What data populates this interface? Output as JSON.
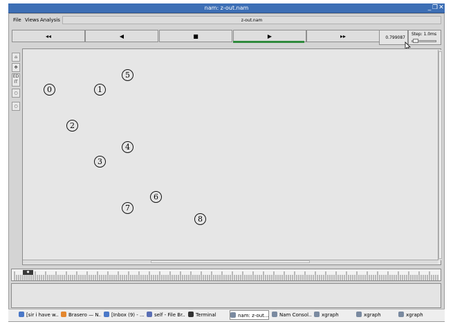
{
  "window": {
    "title": "nam: z-out.nam",
    "file_name": "z-out.nam"
  },
  "menu": {
    "file": "File",
    "views": "Views",
    "analysis": "Analysis"
  },
  "transport": {
    "rewind": "◂◂",
    "back": "◀",
    "stop": "■",
    "play": "▶",
    "fast_forward": "▸▸",
    "time": "0.799087",
    "step_label": "Step: 1.0ms"
  },
  "tools": [
    "⌂",
    "✥",
    "ED IT",
    "○",
    "○"
  ],
  "nodes": [
    {
      "id": "0",
      "label": "0"
    },
    {
      "id": "1",
      "label": "1"
    },
    {
      "id": "2",
      "label": "2"
    },
    {
      "id": "3",
      "label": "3"
    },
    {
      "id": "4",
      "label": "4"
    },
    {
      "id": "5",
      "label": "5"
    },
    {
      "id": "6",
      "label": "6"
    },
    {
      "id": "7",
      "label": "7"
    },
    {
      "id": "8",
      "label": "8"
    }
  ],
  "taskbar": [
    {
      "label": "[sir i have w...",
      "icon_color": "#4a78c8",
      "icon": "browser-icon"
    },
    {
      "label": "Brasero — N...",
      "icon_color": "#e4872e",
      "icon": "brasero-icon"
    },
    {
      "label": "[Inbox (9) - ...",
      "icon_color": "#4a78c8",
      "icon": "mail-icon"
    },
    {
      "label": "self - File Br...",
      "icon_color": "#5a6fb5",
      "icon": "folder-icon"
    },
    {
      "label": "Terminal",
      "icon_color": "#333333",
      "icon": "terminal-icon"
    },
    {
      "label": "nam: z-out....",
      "icon_color": "#7a8aa0",
      "icon": "window-icon"
    },
    {
      "label": "Nam Consol...",
      "icon_color": "#7a8aa0",
      "icon": "window-icon"
    },
    {
      "label": "xgraph",
      "icon_color": "#7a8aa0",
      "icon": "window-icon"
    },
    {
      "label": "xgraph",
      "icon_color": "#7a8aa0",
      "icon": "window-icon"
    },
    {
      "label": "xgraph",
      "icon_color": "#7a8aa0",
      "icon": "window-icon"
    }
  ],
  "colors": {
    "titlebar": "#3d6fb5",
    "play_progress": "#2f8a3c",
    "canvas": "#e6e6e6"
  }
}
